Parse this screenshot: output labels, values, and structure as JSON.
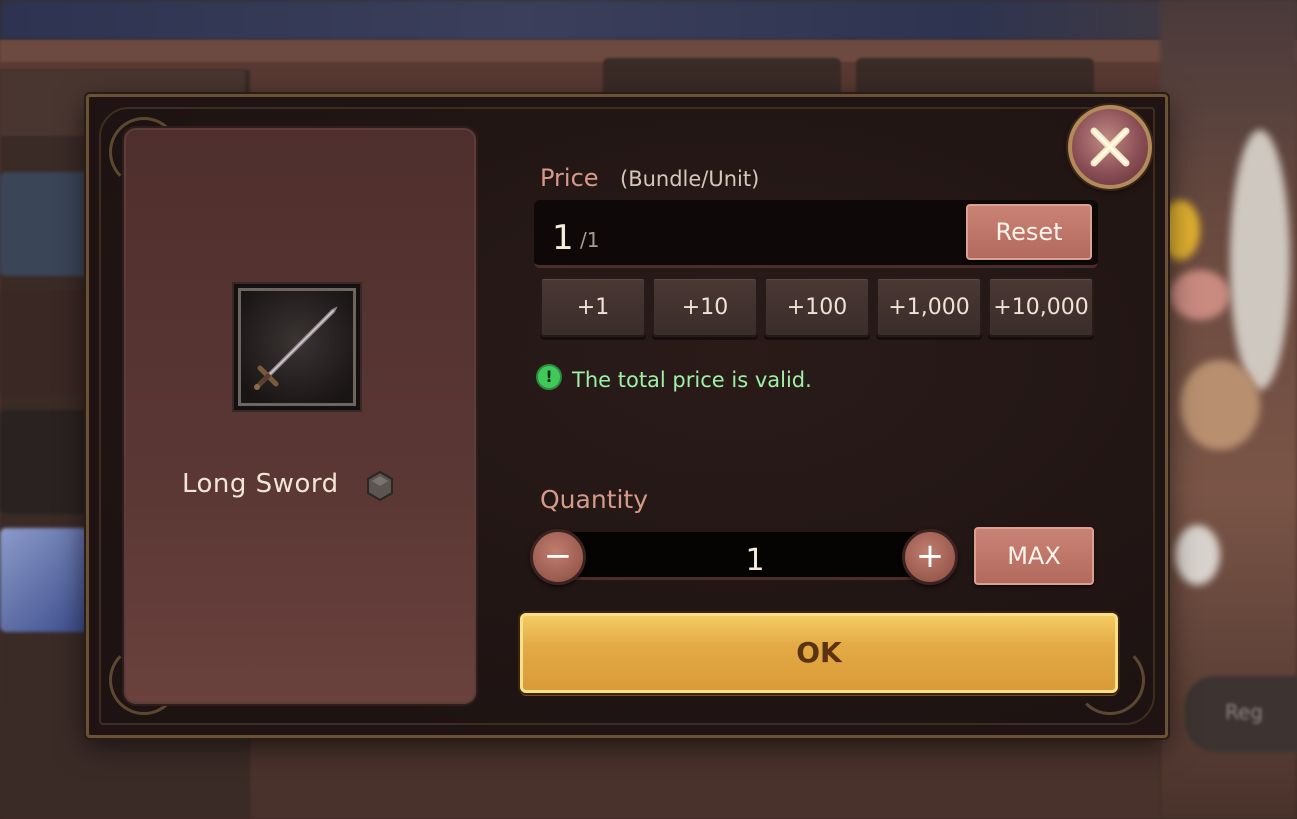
{
  "dialog": {
    "close_icon": "close-x-icon"
  },
  "item": {
    "name": "Long Sword",
    "icon": "long-sword-icon",
    "grade_icon": "grade-gem-icon"
  },
  "price": {
    "label": "Price",
    "sublabel": "(Bundle/Unit)",
    "value": "1",
    "unit": "/1",
    "reset_label": "Reset",
    "increments": [
      "+1",
      "+10",
      "+100",
      "+1,000",
      "+10,000"
    ]
  },
  "validation": {
    "icon": "!",
    "message": "The total price is valid.",
    "color": "#9ef0a6"
  },
  "quantity": {
    "label": "Quantity",
    "value": "1",
    "minus_label": "−",
    "plus_label": "+",
    "max_label": "MAX"
  },
  "ok_label": "OK",
  "background": {
    "register_text": "Reg"
  },
  "colors": {
    "accent_label": "#d59a8a",
    "button_rose": "#b36a5e",
    "ok_gold": "#e3aa45"
  }
}
